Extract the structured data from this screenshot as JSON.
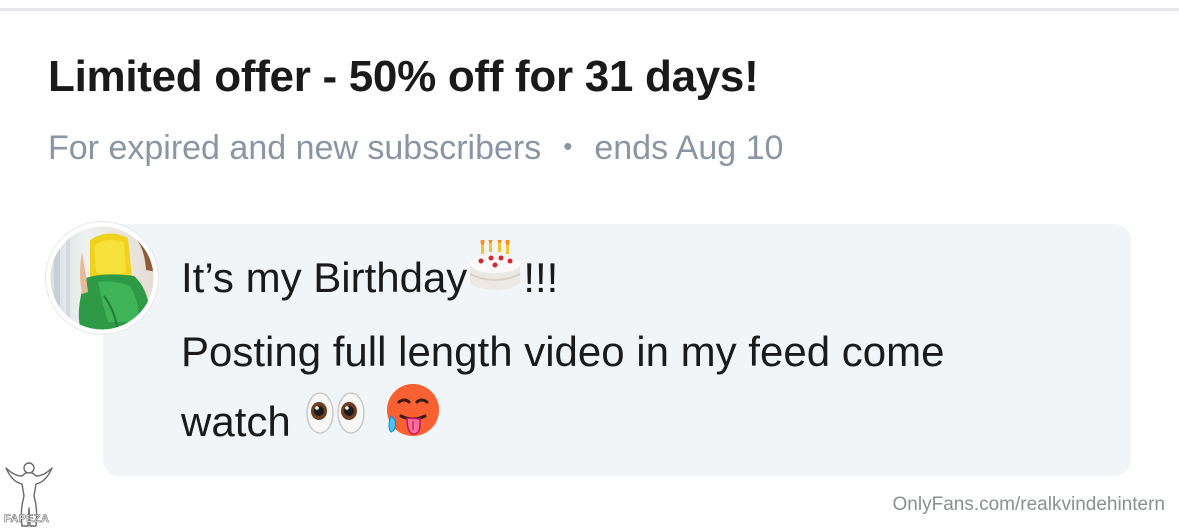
{
  "offer": {
    "title": "Limited offer - 50% off for 31 days!",
    "audience": "For expired and new subscribers",
    "separator": "•",
    "ends": "ends Aug 10"
  },
  "message": {
    "line1_text": "It’s my Birthday",
    "line1_icon": "birthday-cake-icon",
    "line1_suffix": "!!!",
    "line2_text": "Posting full length video in my feed come",
    "line3_text": "watch",
    "line3_icons": [
      "eyes-icon",
      "hot-face-icon"
    ]
  },
  "watermark": {
    "url": "OnlyFans.com/realkvindehintern",
    "corner_logo_text": "FAPEZA"
  },
  "colors": {
    "title": "#1a1a1a",
    "muted": "#8a96a3",
    "bubble": "#f2f5f7",
    "divider": "#e6e8eb"
  }
}
